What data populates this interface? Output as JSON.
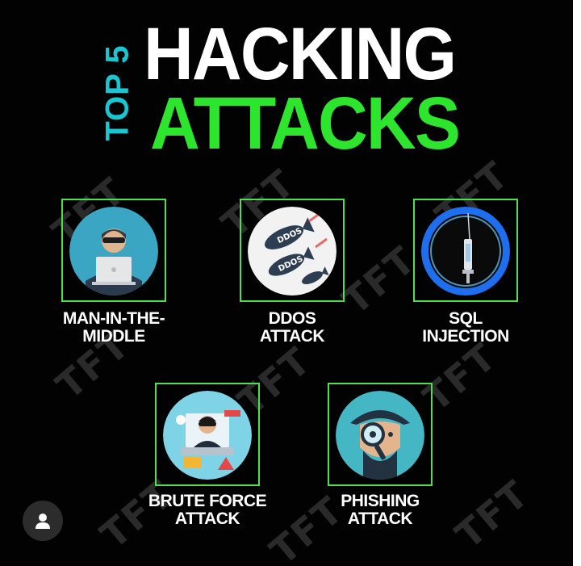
{
  "title": {
    "side_text": "TOP 5",
    "main_text": "HACKING",
    "sub_text": "ATTACKS"
  },
  "watermark_text": "TFT",
  "attacks": [
    {
      "line1": "MAN-IN-THE-",
      "line2": "MIDDLE",
      "icon": "hacker-laptop-icon"
    },
    {
      "line1": "DDOS",
      "line2": "ATTACK",
      "icon": "ddos-bombs-icon",
      "icon_text": "DDOS"
    },
    {
      "line1": "SQL",
      "line2": "INJECTION",
      "icon": "syringe-icon"
    },
    {
      "line1": "BRUTE FORCE",
      "line2": "ATTACK",
      "icon": "burglar-computer-icon"
    },
    {
      "line1": "PHISHING",
      "line2": "ATTACK",
      "icon": "detective-magnifier-icon"
    }
  ],
  "colors": {
    "background": "#020202",
    "accent_green": "#2ee52e",
    "accent_cyan": "#19c7d3",
    "tile_border": "#4fe04f"
  }
}
